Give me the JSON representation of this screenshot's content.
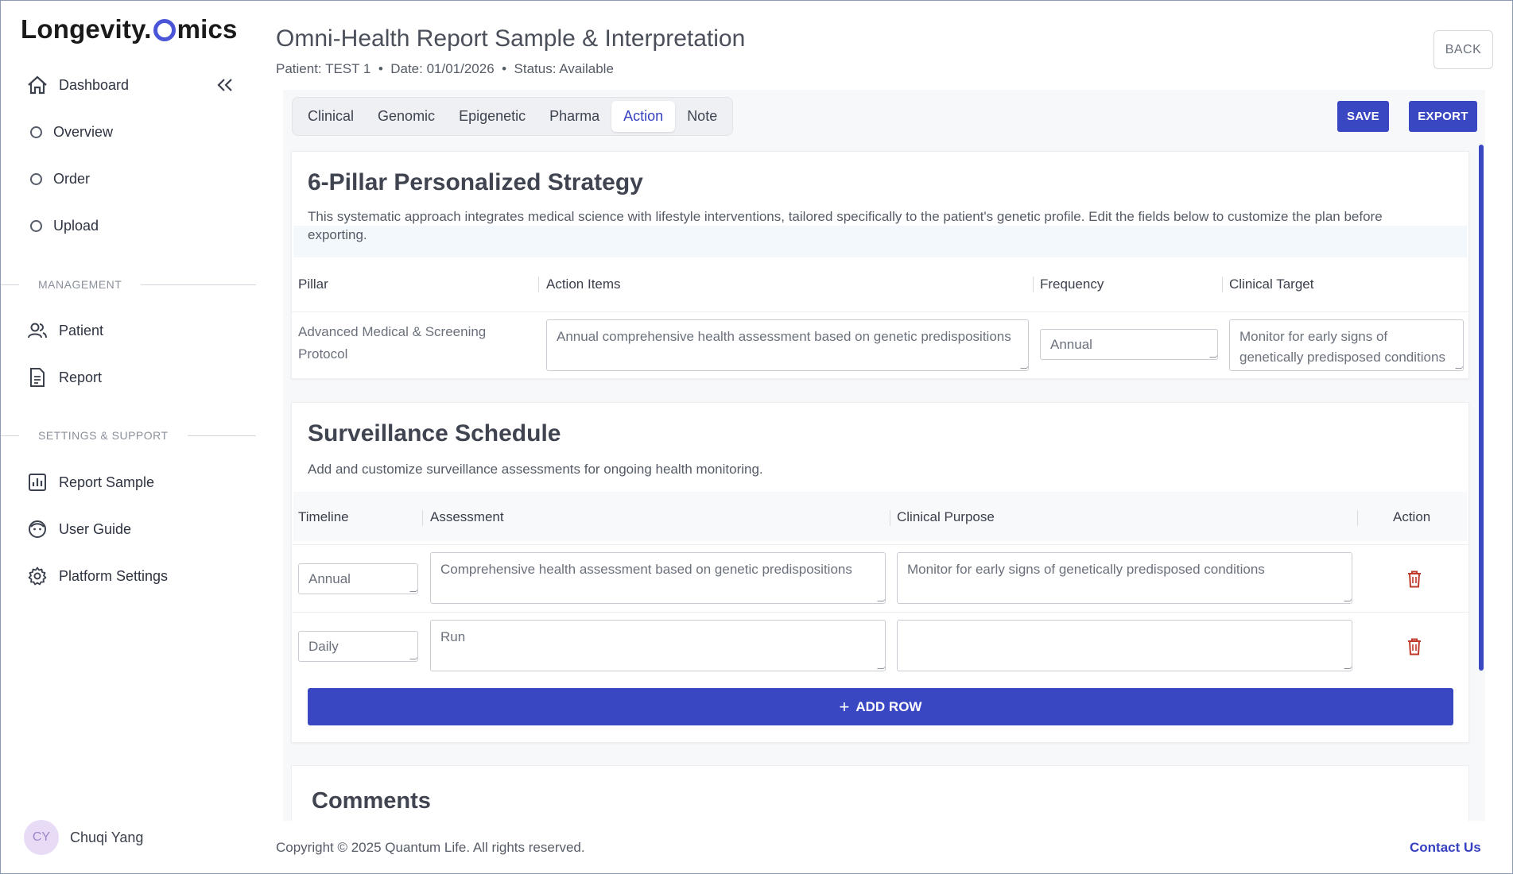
{
  "app": {
    "logo_pre": "Longevity.",
    "logo_post": "mics"
  },
  "sidebar": {
    "dashboard": "Dashboard",
    "sub_items": [
      "Overview",
      "Order",
      "Upload"
    ],
    "management_label": "MANAGEMENT",
    "management_items": [
      "Patient",
      "Report"
    ],
    "settings_label": "SETTINGS & SUPPORT",
    "settings_items": [
      "Report Sample",
      "User Guide",
      "Platform Settings"
    ],
    "user_initials": "CY",
    "user_name": "Chuqi Yang"
  },
  "header": {
    "title": "Omni-Health Report Sample & Interpretation",
    "meta": "Patient: TEST 1  •  Date: 01/01/2026  •  Status: Available",
    "back": "BACK"
  },
  "tabs": [
    "Clinical",
    "Genomic",
    "Epigenetic",
    "Pharma",
    "Action",
    "Note"
  ],
  "active_tab": "Action",
  "toolbar": {
    "save": "SAVE",
    "export": "EXPORT"
  },
  "strategy": {
    "title": "6-Pillar Personalized Strategy",
    "description": "This systematic approach integrates medical science with lifestyle interventions, tailored specifically to the patient's genetic profile. Edit the fields below to customize the plan before exporting.",
    "columns": [
      "Pillar",
      "Action Items",
      "Frequency",
      "Clinical Target"
    ],
    "rows": [
      {
        "pillar": "Advanced Medical & Screening Protocol",
        "action_items": "Annual comprehensive health assessment based on genetic predispositions",
        "frequency": "Annual",
        "clinical_target": "Monitor for early signs of genetically predisposed conditions"
      }
    ]
  },
  "surveillance": {
    "title": "Surveillance Schedule",
    "description": "Add and customize surveillance assessments for ongoing health monitoring.",
    "columns": [
      "Timeline",
      "Assessment",
      "Clinical Purpose",
      "Action"
    ],
    "rows": [
      {
        "timeline": "Annual",
        "assessment": "Comprehensive health assessment based on genetic predispositions",
        "purpose": "Monitor for early signs of genetically predisposed conditions"
      },
      {
        "timeline": "Daily",
        "assessment": "Run",
        "purpose": ""
      }
    ],
    "add_row": "ADD ROW"
  },
  "comments": {
    "title": "Comments"
  },
  "footer": {
    "copyright": "Copyright © 2025 Quantum Life. All rights reserved.",
    "contact": "Contact Us"
  },
  "colors": {
    "accent": "#3a47c3",
    "logo_ring": "#4b55d8",
    "avatar_bg": "#e7dbf5",
    "trash": "#c0392b"
  },
  "icons": {
    "dashboard": "home-icon",
    "collapse": "double-chevron-left-icon",
    "patient": "users-icon",
    "report": "document-icon",
    "report_sample": "bar-chart-icon",
    "user_guide": "face-icon",
    "platform_settings": "gear-icon",
    "delete": "trash-icon",
    "add": "plus-icon"
  }
}
